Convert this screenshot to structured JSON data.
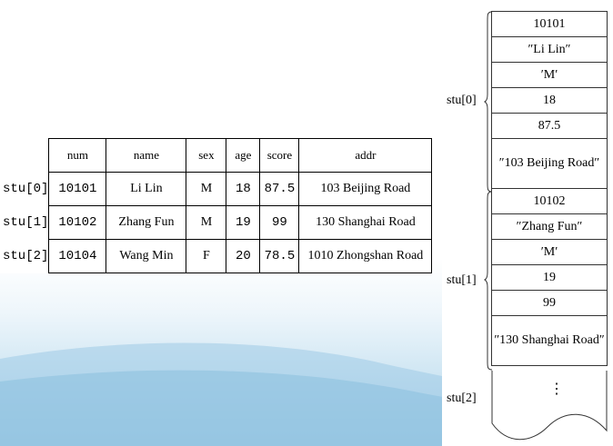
{
  "table": {
    "headers": [
      "num",
      "name",
      "sex",
      "age",
      "score",
      "addr"
    ],
    "rows": [
      {
        "label": "stu[0]",
        "num": "10101",
        "name": "Li Lin",
        "sex": "M",
        "age": "18",
        "score": "87.5",
        "addr": "103 Beijing Road"
      },
      {
        "label": "stu[1]",
        "num": "10102",
        "name": "Zhang Fun",
        "sex": "M",
        "age": "19",
        "score": "99",
        "addr": "130 Shanghai Road"
      },
      {
        "label": "stu[2]",
        "num": "10104",
        "name": "Wang Min",
        "sex": "F",
        "age": "20",
        "score": "78.5",
        "addr": "1010 Zhongshan Road"
      }
    ]
  },
  "memory": {
    "labels": [
      "stu[0]",
      "stu[1]",
      "stu[2]"
    ],
    "stu0": [
      "10101",
      "″Li  Lin″",
      "′M′",
      "18",
      "87.5",
      "″103 Beijing Road″"
    ],
    "stu1": [
      "10102",
      "″Zhang Fun″",
      "′M′",
      "19",
      "99",
      "″130 Shanghai Road″"
    ],
    "stu2_ellipsis": "⋮"
  }
}
